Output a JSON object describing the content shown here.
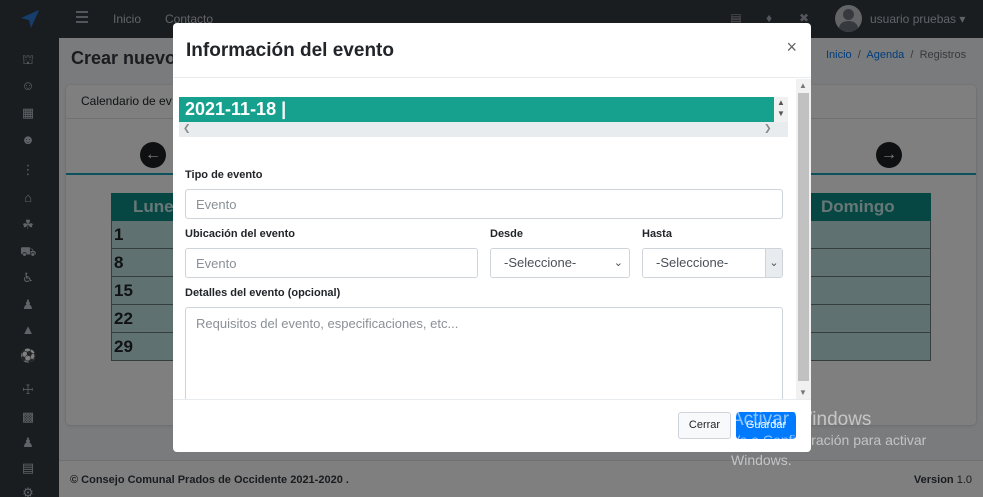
{
  "topbar": {
    "nav_home": "Inicio",
    "nav_contact": "Contacto",
    "user_name": "usuario pruebas"
  },
  "page": {
    "title": "Crear nuevo",
    "breadcrumb": {
      "home": "Inicio",
      "agenda": "Agenda",
      "current": "Registros"
    },
    "card_header": "Calendario de ev"
  },
  "calendar": {
    "first_day": "Lune",
    "last_day": "Domingo",
    "rows": [
      "1",
      "8",
      "15",
      "22",
      "29"
    ]
  },
  "footer": {
    "copyright": "© Consejo Comunal Prados de Occidente 2021-2020 .",
    "version_label": "Version",
    "version_value": "1.0"
  },
  "modal": {
    "title": "Información del evento",
    "close_symbol": "×",
    "date": "2021-11-18 |",
    "event_type_label": "Tipo de evento",
    "event_type_placeholder": "Evento",
    "location_label": "Ubicación del evento",
    "location_placeholder": "Evento",
    "from_label": "Desde",
    "from_value": "-Seleccione-",
    "to_label": "Hasta",
    "to_value": "-Seleccione-",
    "details_label": "Detalles del evento (opcional)",
    "details_placeholder": "Requisitos del evento, especificaciones, etc...",
    "cancel_button": "Cerrar",
    "save_button": "Guardar"
  },
  "watermark": {
    "title": "Activar Windows",
    "line1": "Ve a Configuración para activar",
    "line2": "Windows."
  },
  "colors": {
    "sidebar": "#343a40",
    "date_bar": "#16a08e",
    "primary": "#007bff",
    "calendar_header": "#0f8e86",
    "calendar_row": "#bfe5e2"
  }
}
